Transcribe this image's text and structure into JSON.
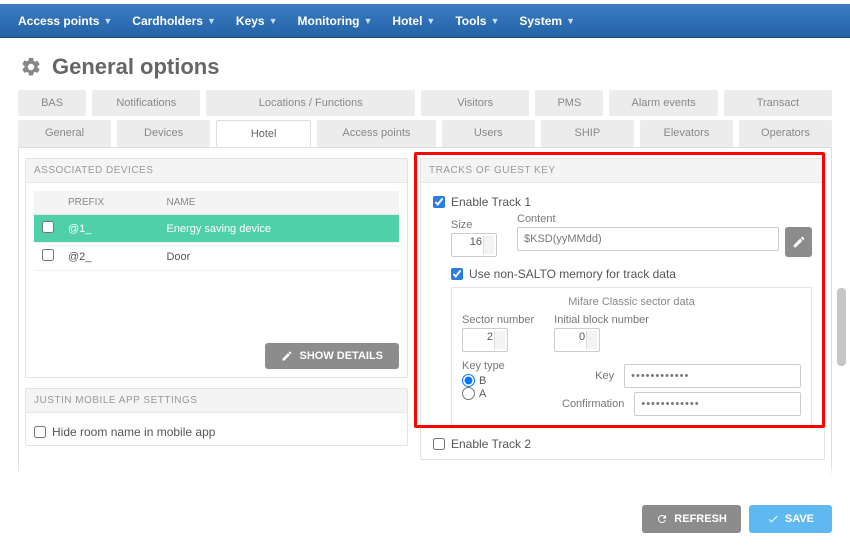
{
  "nav": [
    "Access points",
    "Cardholders",
    "Keys",
    "Monitoring",
    "Hotel",
    "Tools",
    "System"
  ],
  "page_title": "General options",
  "tabs_row1": [
    "BAS",
    "Notifications",
    "Locations / Functions",
    "Visitors",
    "PMS",
    "Alarm events",
    "Transact"
  ],
  "tabs_row2": [
    "General",
    "Devices",
    "Hotel",
    "Access points",
    "Users",
    "SHIP",
    "Elevators",
    "Operators"
  ],
  "active_tab2": "Hotel",
  "assoc_panel": {
    "title": "ASSOCIATED DEVICES",
    "cols": [
      "PREFIX",
      "NAME"
    ],
    "rows": [
      {
        "prefix": "@1_",
        "name": "Energy saving device",
        "selected": true
      },
      {
        "prefix": "@2_",
        "name": "Door",
        "selected": false
      }
    ],
    "show_details": "SHOW DETAILS"
  },
  "justin_panel": {
    "title": "JUSTIN MOBILE APP SETTINGS",
    "opt1": "Hide room name in mobile app"
  },
  "tracks_panel": {
    "title": "TRACKS OF GUEST KEY",
    "enable1": "Enable Track 1",
    "size_lbl": "Size",
    "size_val": "16",
    "content_lbl": "Content",
    "content_val": "$KSD(yyMMdd)",
    "use_nonsalto": "Use non-SALTO memory for track data",
    "mifare_title": "Mifare Classic sector data",
    "sector_lbl": "Sector number",
    "sector_val": "2",
    "initblock_lbl": "Initial block number",
    "initblock_val": "0",
    "keytype_lbl": "Key type",
    "keytype_b": "B",
    "keytype_a": "A",
    "key_lbl": "Key",
    "key_val": "••••••••••••",
    "conf_lbl": "Confirmation",
    "conf_val": "••••••••••••",
    "enable2": "Enable Track 2"
  },
  "footer": {
    "refresh": "REFRESH",
    "save": "SAVE"
  }
}
